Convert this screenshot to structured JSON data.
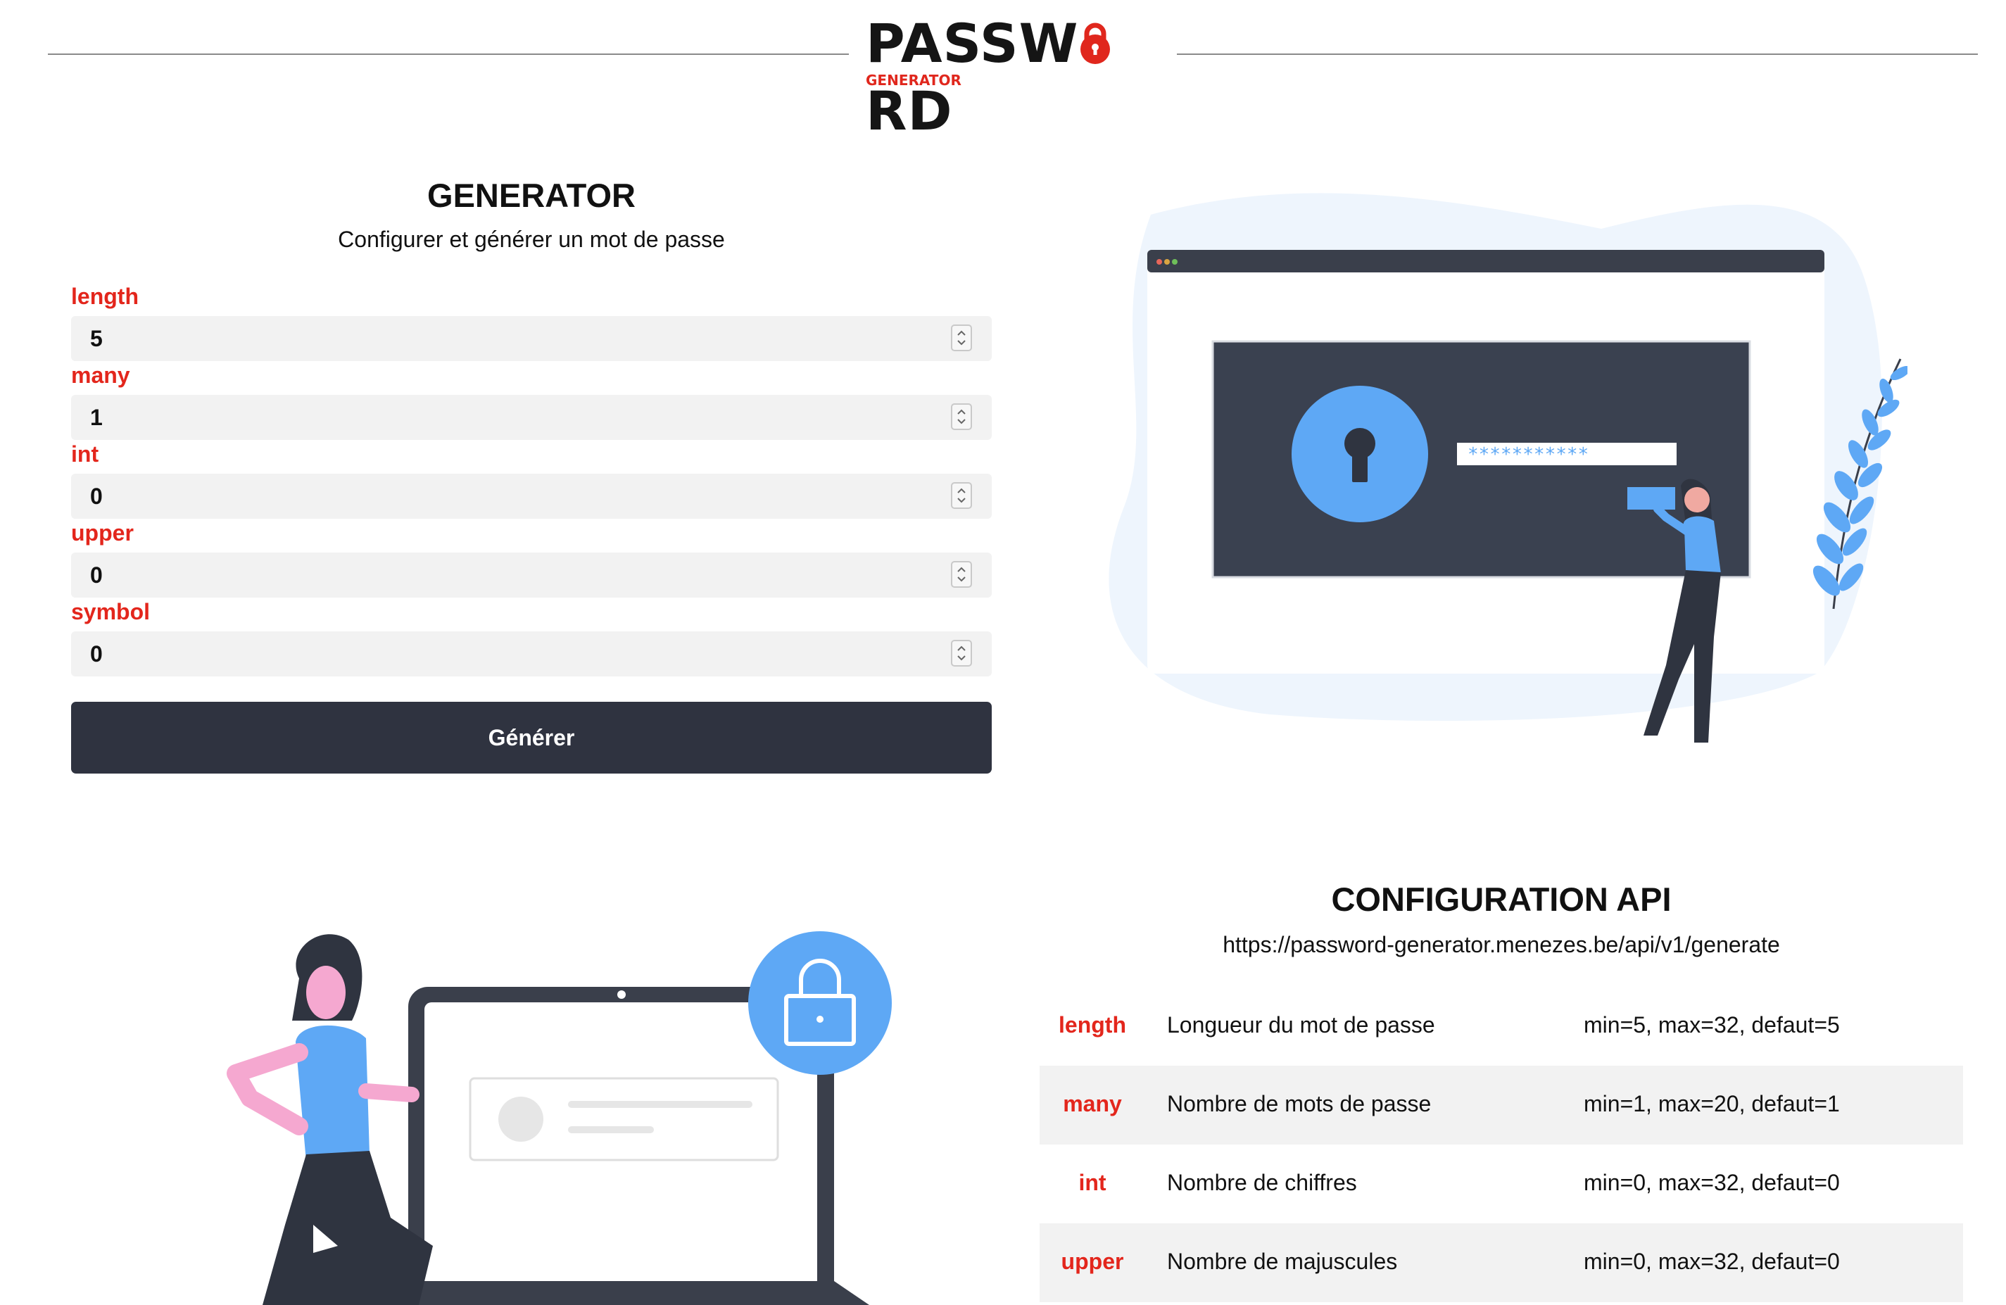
{
  "header": {
    "logo_word": "PASSW RD",
    "logo_word_left": "PASSW",
    "logo_word_right": "RD",
    "logo_sub": "GENERATOR",
    "colors": {
      "logo_dark": "#151515",
      "logo_red": "#e0271d"
    }
  },
  "generator": {
    "title": "GENERATOR",
    "subtitle": "Configurer et générer un mot de passe",
    "fields": [
      {
        "label": "length",
        "value": "5"
      },
      {
        "label": "many",
        "value": "1"
      },
      {
        "label": "int",
        "value": "0"
      },
      {
        "label": "upper",
        "value": "0"
      },
      {
        "label": "symbol",
        "value": "0"
      }
    ],
    "button_label": "Générer",
    "colors": {
      "label": "#e3261c",
      "button": "#2f3340",
      "input_bg": "#f2f2f2"
    }
  },
  "illustration_top": {
    "password_mask": "***********",
    "icon": "keyhole-lock-icon"
  },
  "illustration_bottom": {
    "icon": "padlock-icon"
  },
  "api": {
    "title": "CONFIGURATION API",
    "url": "https://password-generator.menezes.be/api/v1/generate",
    "params": [
      {
        "name": "length",
        "description": "Longueur du mot de passe",
        "range": "min=5, max=32, defaut=5"
      },
      {
        "name": "many",
        "description": "Nombre de mots de passe",
        "range": "min=1, max=20, defaut=1"
      },
      {
        "name": "int",
        "description": "Nombre de chiffres",
        "range": "min=0, max=32, defaut=0"
      },
      {
        "name": "upper",
        "description": "Nombre de majuscules",
        "range": "min=0, max=32, defaut=0"
      }
    ]
  }
}
